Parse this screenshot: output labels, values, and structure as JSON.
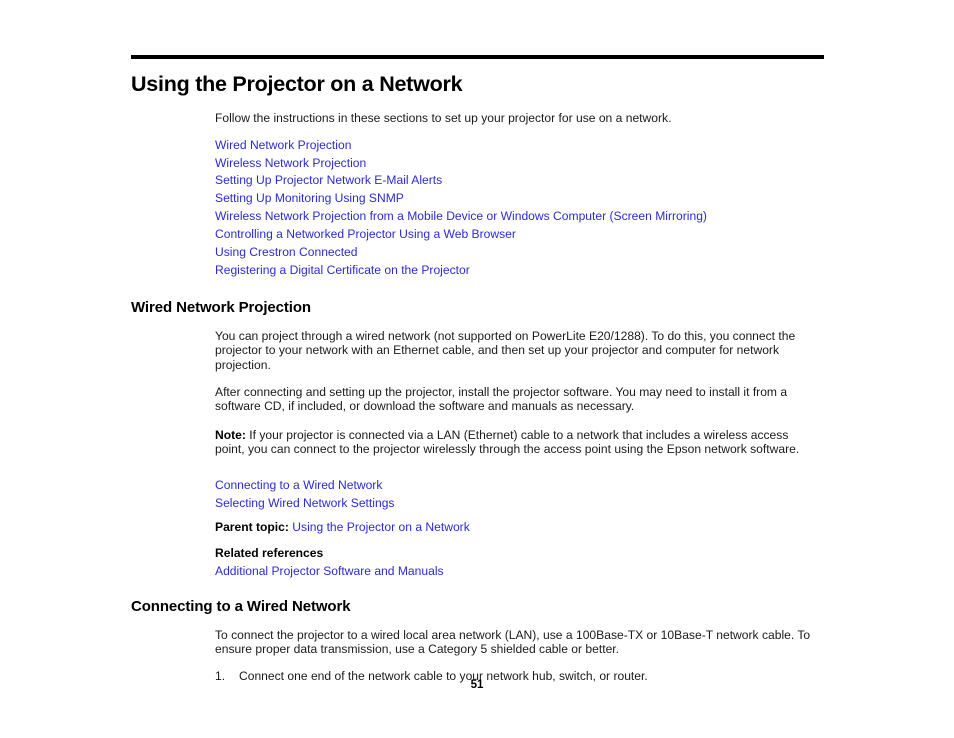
{
  "document": {
    "page_number": "51",
    "link_color": "#2b2bd4",
    "text_color": "#1a1a1a",
    "rule_color": "#000000"
  },
  "chapter": {
    "title": "Using the Projector on a Network",
    "intro": "Follow the instructions in these sections to set up your projector for use on a network.",
    "toc_links": [
      "Wired Network Projection",
      "Wireless Network Projection",
      "Setting Up Projector Network E-Mail Alerts",
      "Setting Up Monitoring Using SNMP",
      "Wireless Network Projection from a Mobile Device or Windows Computer (Screen Mirroring)",
      "Controlling a Networked Projector Using a Web Browser",
      "Using Crestron Connected",
      "Registering a Digital Certificate on the Projector"
    ]
  },
  "section_wired": {
    "title": "Wired Network Projection",
    "paragraph_1": "You can project through a wired network (not supported on PowerLite E20/1288). To do this, you connect the projector to your network with an Ethernet cable, and then set up your projector and computer for network projection.",
    "paragraph_2": "After connecting and setting up the projector, install the projector software. You may need to install it from a software CD, if included, or download the software and manuals as necessary.",
    "note_label": "Note:",
    "note_text": " If your projector is connected via a LAN (Ethernet) cable to a network that includes a wireless access point, you can connect to the projector wirelessly through the access point using the Epson network software.",
    "sub_links": [
      "Connecting to a Wired Network",
      "Selecting Wired Network Settings"
    ],
    "parent_topic_label": "Parent topic:",
    "parent_topic_link": "Using the Projector on a Network",
    "related_references_label": "Related references",
    "related_references_link": "Additional Projector Software and Manuals"
  },
  "section_connecting": {
    "title": "Connecting to a Wired Network",
    "paragraph_1": "To connect the projector to a wired local area network (LAN), use a 100Base-TX or 10Base-T network cable. To ensure proper data transmission, use a Category 5 shielded cable or better.",
    "steps": [
      {
        "number": "1.",
        "text": "Connect one end of the network cable to your network hub, switch, or router."
      }
    ]
  }
}
